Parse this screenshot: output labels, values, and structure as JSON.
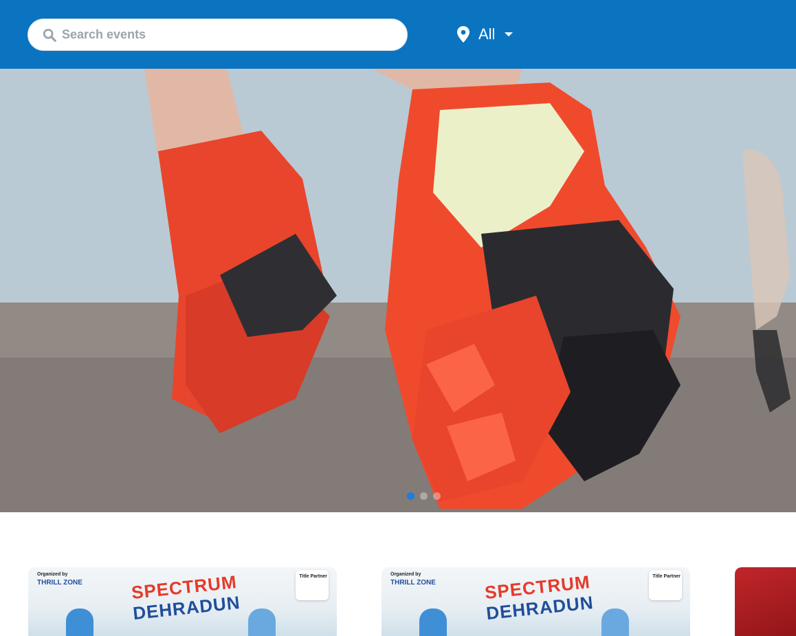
{
  "header": {
    "search": {
      "placeholder": "Search events",
      "value": ""
    },
    "location": {
      "label": "All"
    }
  },
  "hero": {
    "slides_total": 3,
    "active_slide": 1
  },
  "cards": [
    {
      "organizer_label": "Organized by",
      "organizer": "THRILL ZONE",
      "partner_label": "Title Partner",
      "title_line1": "SPECTRUM",
      "title_line2": "DEHRADUN"
    },
    {
      "organizer_label": "Organized by",
      "organizer": "THRILL ZONE",
      "partner_label": "Title Partner",
      "title_line1": "SPECTRUM",
      "title_line2": "DEHRADUN"
    },
    {
      "organizer_label": "",
      "organizer": "",
      "partner_label": "",
      "title_line1": "",
      "title_line2": ""
    }
  ],
  "colors": {
    "header": "#0a74c1",
    "active_dot": "#1a7fe0",
    "shoe": "#e8452c"
  },
  "icons": {
    "search": "search-icon",
    "location": "map-pin-icon",
    "dropdown": "caret-down-icon"
  }
}
